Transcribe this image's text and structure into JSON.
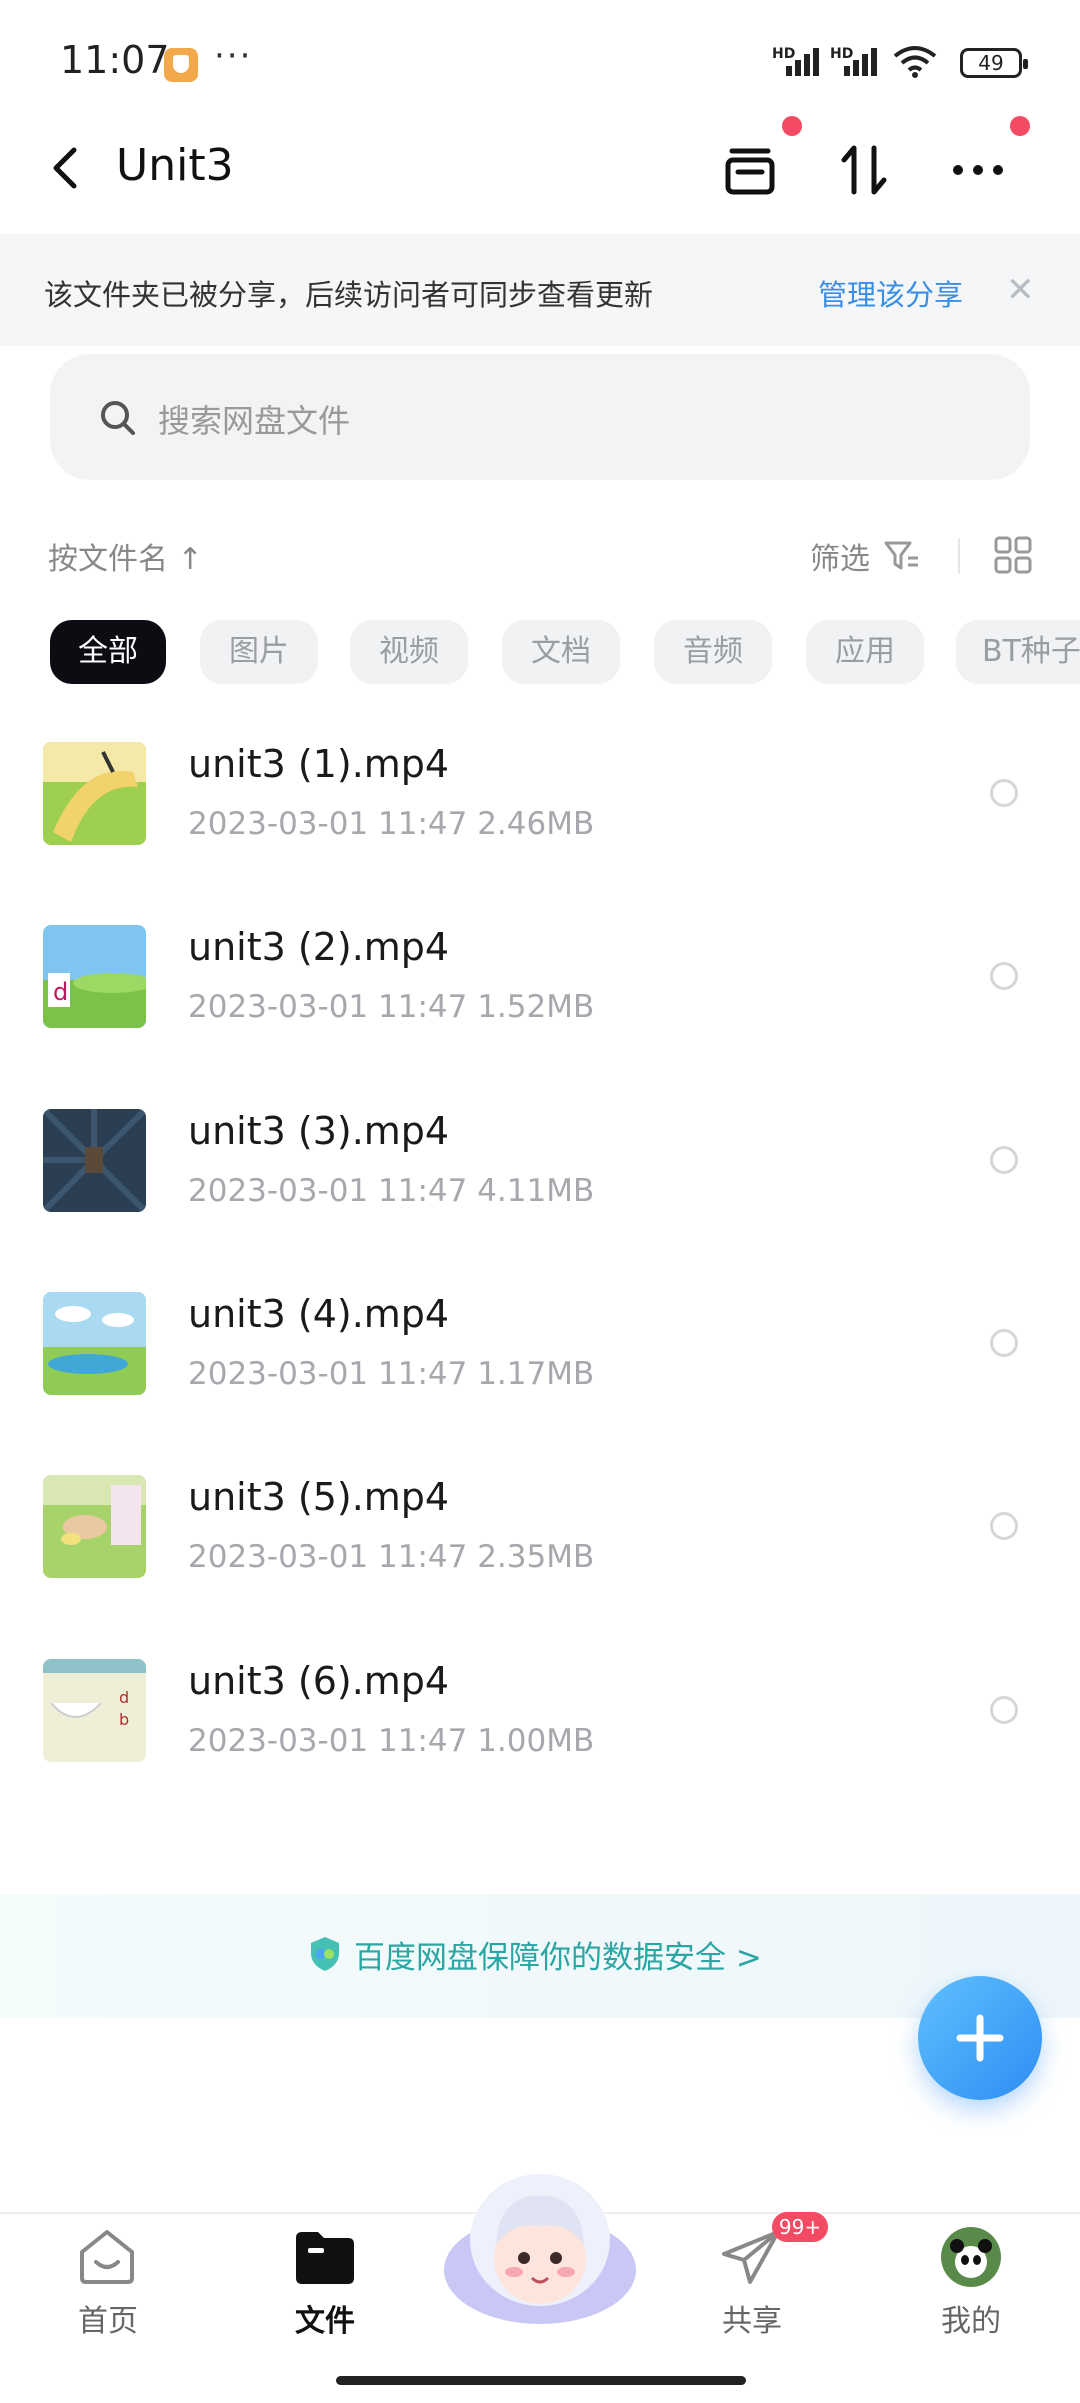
{
  "status_bar": {
    "time": "11:07",
    "dots": "···",
    "hd1": "HD",
    "hd2": "HD",
    "battery": "49"
  },
  "header": {
    "title": "Unit3",
    "back_icon": "chevron-left-icon",
    "archive_icon": "archive-icon",
    "sort_icon": "transfer-icon",
    "more_icon": "more-dots-icon"
  },
  "notice": {
    "text": "该文件夹已被分享，后续访问者可同步查看更新",
    "link": "管理该分享",
    "close": "✕"
  },
  "search": {
    "placeholder": "搜索网盘文件"
  },
  "sort": {
    "label": "按文件名 ↑",
    "filter_label": "筛选"
  },
  "chips": [
    "全部",
    "图片",
    "视频",
    "文档",
    "音频",
    "应用",
    "BT种子"
  ],
  "files": [
    {
      "name": "unit3 (1).mp4",
      "meta": "2023-03-01  11:47  2.46MB"
    },
    {
      "name": "unit3 (2).mp4",
      "meta": "2023-03-01  11:47  1.52MB"
    },
    {
      "name": "unit3 (3).mp4",
      "meta": "2023-03-01  11:47  4.11MB"
    },
    {
      "name": "unit3 (4).mp4",
      "meta": "2023-03-01  11:47  1.17MB"
    },
    {
      "name": "unit3 (5).mp4",
      "meta": "2023-03-01  11:47  2.35MB"
    },
    {
      "name": "unit3 (6).mp4",
      "meta": "2023-03-01  11:47  1.00MB"
    }
  ],
  "banner": {
    "text": "百度网盘保障你的数据安全 >"
  },
  "nav": {
    "home": "首页",
    "files": "文件",
    "share": "共享",
    "mine": "我的",
    "badge": "99+"
  },
  "colors": {
    "accent": "#3a8ee6",
    "active_chip": "#0c0d12",
    "red_dot": "#f24b63",
    "banner_text": "#2aa6a3"
  }
}
